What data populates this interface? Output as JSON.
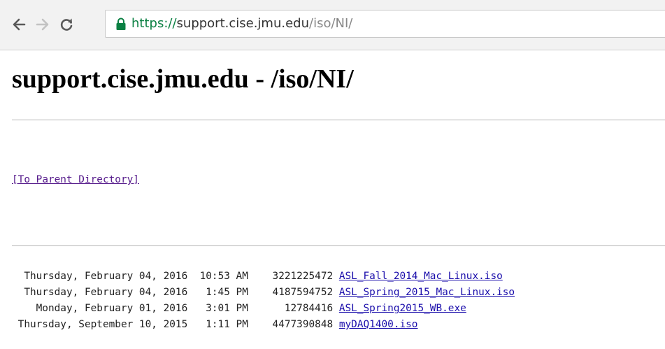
{
  "browser": {
    "url_scheme": "https://",
    "url_host": "support.cise.jmu.edu",
    "url_path": "/iso/NI/",
    "icons": {
      "back": "arrow-left-icon",
      "forward": "arrow-right-icon",
      "reload": "reload-icon",
      "secure": "lock-icon"
    },
    "secure_color": "#0b8043"
  },
  "page": {
    "heading": "support.cise.jmu.edu - /iso/NI/",
    "parent_link": "[To Parent Directory]",
    "files": [
      {
        "date": "Thursday, February 04, 2016",
        "time": "10:53 AM",
        "size": "3221225472",
        "name": "ASL_Fall_2014_Mac_Linux.iso"
      },
      {
        "date": "Thursday, February 04, 2016",
        "time": "1:45 PM",
        "size": "4187594752",
        "name": "ASL_Spring_2015_Mac_Linux.iso"
      },
      {
        "date": "Monday, February 01, 2016",
        "time": "3:01 PM",
        "size": "12784416",
        "name": "ASL_Spring2015_WB.exe"
      },
      {
        "date": "Thursday, September 10, 2015",
        "time": "1:11 PM",
        "size": "4477390848",
        "name": "myDAQ1400.iso"
      }
    ]
  }
}
